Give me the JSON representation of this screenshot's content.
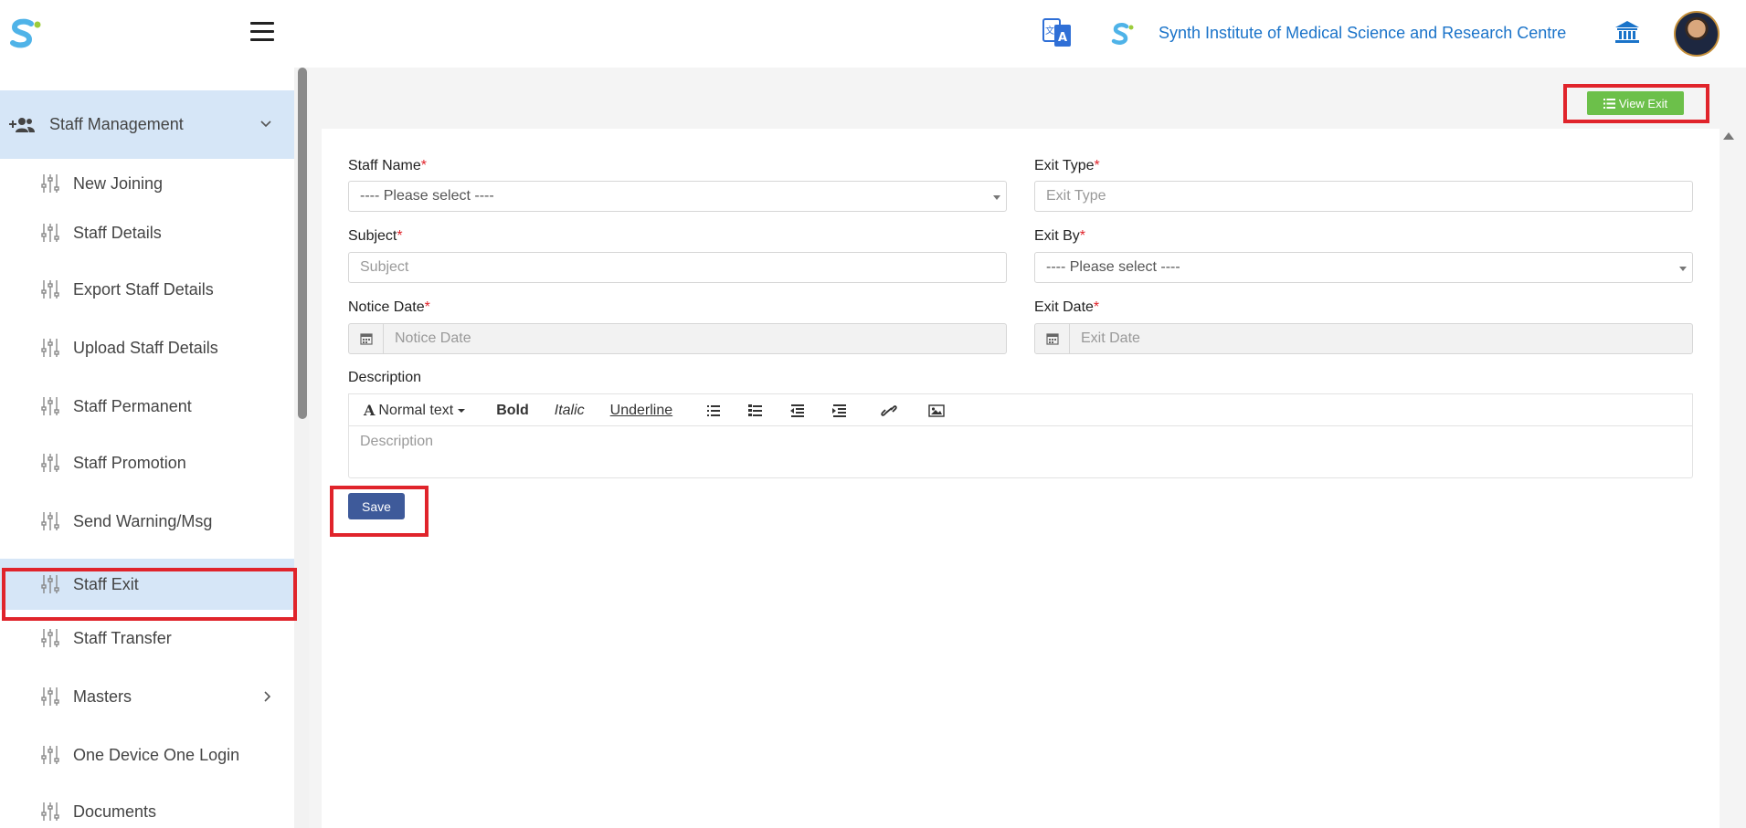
{
  "header": {
    "institute_name": "Synth Institute of Medical Science and Research Centre"
  },
  "sidebar": {
    "parent": {
      "label": "Staff Management",
      "icon": "user-plus-icon"
    },
    "items": [
      {
        "label": "New Joining"
      },
      {
        "label": "Staff Details"
      },
      {
        "label": "Export Staff Details"
      },
      {
        "label": "Upload Staff Details"
      },
      {
        "label": "Staff Permanent"
      },
      {
        "label": "Staff Promotion"
      },
      {
        "label": "Send Warning/Msg"
      },
      {
        "label": "Staff Exit",
        "active": true
      },
      {
        "label": "Staff Transfer"
      },
      {
        "label": "Masters",
        "has_children": true
      },
      {
        "label": "One Device One Login"
      },
      {
        "label": "Documents"
      }
    ]
  },
  "toolbar": {
    "view_exit_label": "View Exit"
  },
  "form": {
    "staff_name": {
      "label": "Staff Name",
      "required": "*",
      "value": "---- Please select ----"
    },
    "exit_type": {
      "label": "Exit Type",
      "required": "*",
      "placeholder": "Exit Type"
    },
    "subject": {
      "label": "Subject",
      "required": "*",
      "placeholder": "Subject"
    },
    "exit_by": {
      "label": "Exit By",
      "required": "*",
      "value": "---- Please select ----"
    },
    "notice_date": {
      "label": "Notice Date",
      "required": "*",
      "placeholder": "Notice Date"
    },
    "exit_date": {
      "label": "Exit Date",
      "required": "*",
      "placeholder": "Exit Date"
    },
    "description": {
      "label": "Description",
      "placeholder": "Description",
      "toolbar": {
        "style_label": "Normal text",
        "bold_label": "Bold",
        "italic_label": "Italic",
        "underline_label": "Underline"
      }
    },
    "save_label": "Save"
  },
  "colors": {
    "accent": "#1a73c9",
    "active_bg": "#d6e6f7",
    "view_exit_bg": "#6cc04a",
    "save_bg": "#3e5a9a",
    "highlight": "#e0242b"
  }
}
